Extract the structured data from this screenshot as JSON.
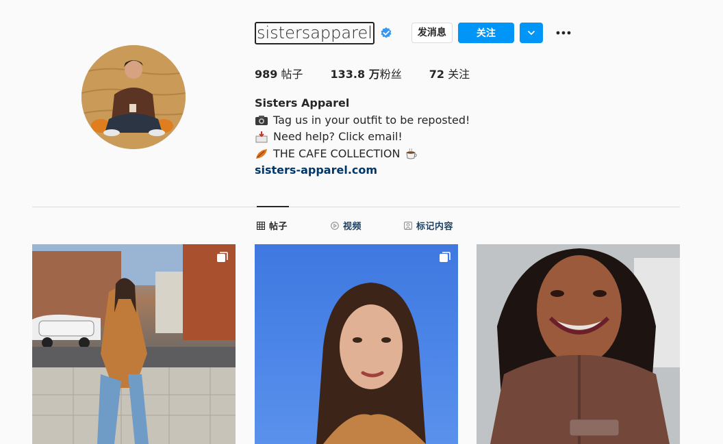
{
  "profile": {
    "username": "sistersapparel",
    "verified": true,
    "buttons": {
      "message_label": "发消息",
      "follow_label": "关注"
    },
    "stats": {
      "posts_count": "989",
      "posts_label": "帖子",
      "followers_count": "133.8 万",
      "followers_label": "粉丝",
      "following_count": "72",
      "following_label": "关注"
    },
    "bio": {
      "full_name": "Sisters Apparel",
      "line1": "Tag us in your outfit to be reposted!",
      "line1_icon": "camera-emoji",
      "line2": "Need help? Click email!",
      "line2_icon": "inbox-emoji",
      "line3": "THE CAFE COLLECTION",
      "line3_icon_left": "leaf-emoji",
      "line3_icon_right": "coffee-emoji",
      "link": "sisters-apparel.com"
    }
  },
  "tabs": [
    {
      "label": "帖子",
      "icon": "grid-icon",
      "active": true
    },
    {
      "label": "视频",
      "icon": "play-icon",
      "active": false
    },
    {
      "label": "标记内容",
      "icon": "tag-icon",
      "active": false
    }
  ],
  "posts": [
    {
      "icon": "carousel-icon"
    },
    {
      "icon": "carousel-icon"
    },
    {
      "icon": ""
    }
  ],
  "colors": {
    "accent": "#0095f6",
    "link": "#00376b",
    "background": "#fafafa",
    "divider": "#dbdbdb"
  }
}
